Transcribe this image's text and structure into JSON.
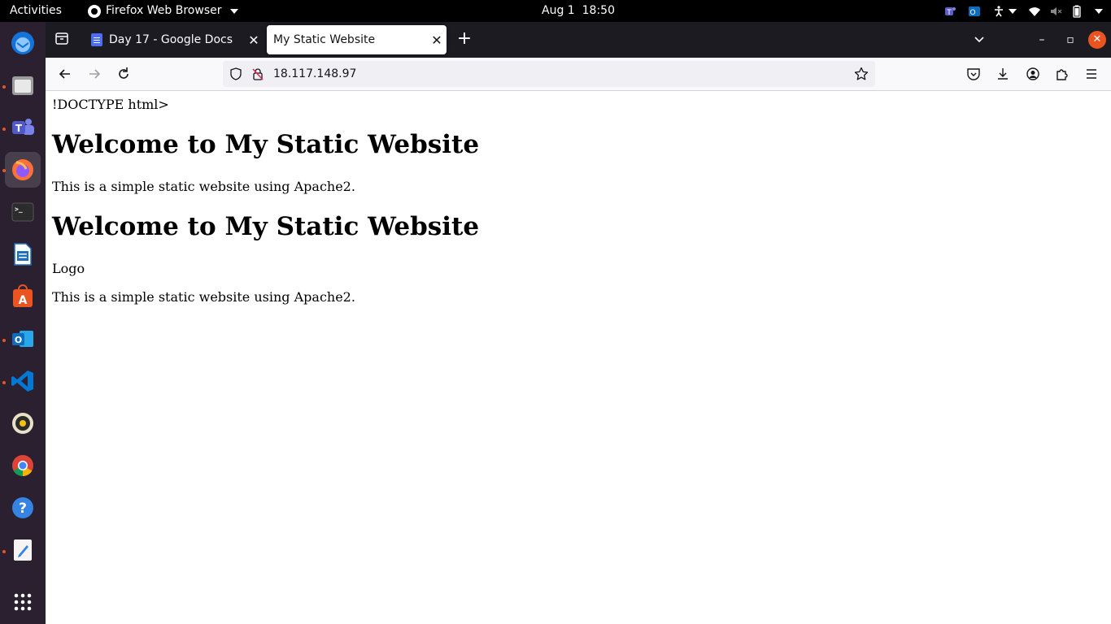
{
  "topbar": {
    "activities": "Activities",
    "app_name": "Firefox Web Browser",
    "date": "Aug 1",
    "time": "18:50"
  },
  "dock": {
    "items": [
      "thunderbird-icon",
      "files-icon",
      "teams-icon",
      "firefox-icon",
      "terminal-icon",
      "writer-icon",
      "software-icon",
      "outlook-icon",
      "vscode-icon",
      "rhythmbox-icon",
      "chrome-icon",
      "help-icon",
      "text-editor-icon",
      "app-grid-icon"
    ]
  },
  "browser": {
    "tabs": [
      {
        "title": "Day 17 - Google Docs",
        "active": false
      },
      {
        "title": "My Static Website",
        "active": true
      }
    ],
    "url": "18.117.148.97"
  },
  "page": {
    "doctype_text": "!DOCTYPE html>",
    "heading_1": "Welcome to My Static Website",
    "paragraph_1": "This is a simple static website using Apache2.",
    "heading_2": "Welcome to My Static Website",
    "logo_text": "Logo",
    "paragraph_2": "This is a simple static website using Apache2."
  },
  "colors": {
    "topbar": "#000000",
    "dock": "#2a2030",
    "tabstrip": "#1c1b22",
    "accent": "#e95420"
  }
}
